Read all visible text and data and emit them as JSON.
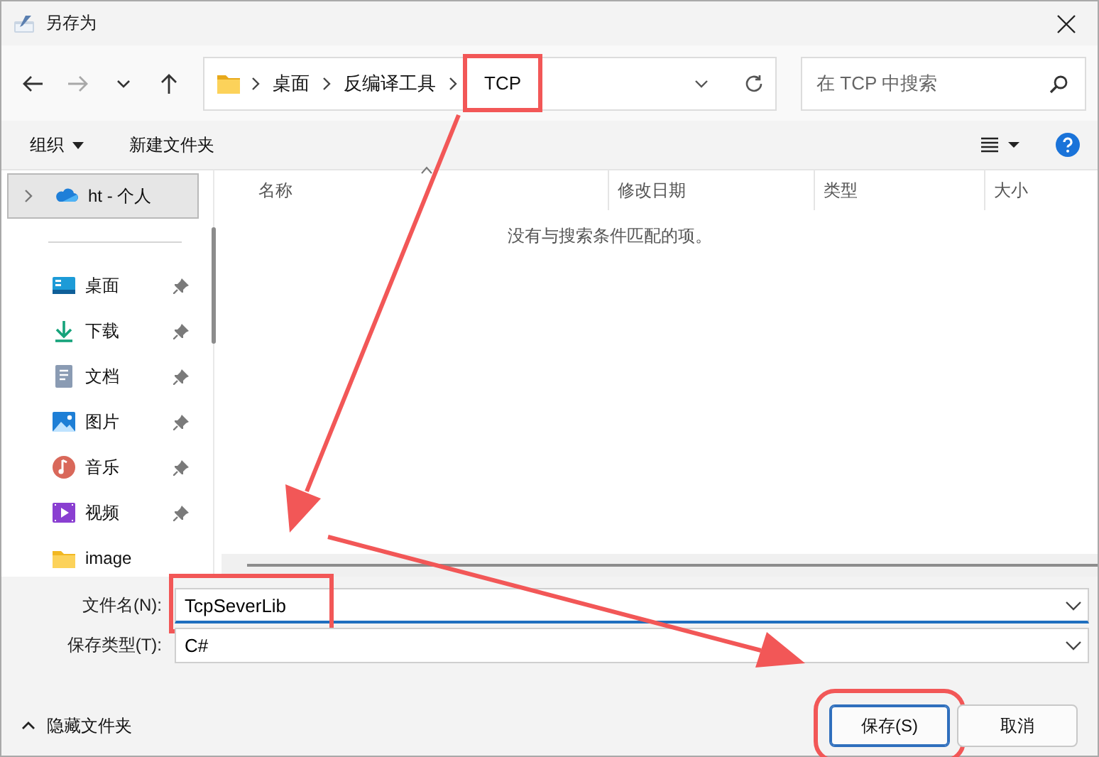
{
  "window": {
    "title": "另存为"
  },
  "nav_buttons": [
    {
      "kind": "back",
      "disabled": false
    },
    {
      "kind": "forward",
      "disabled": true
    },
    {
      "kind": "recent",
      "disabled": false
    },
    {
      "kind": "up",
      "disabled": false
    }
  ],
  "address": {
    "path": [
      {
        "label": "桌面",
        "highlighted": false
      },
      {
        "label": "反编译工具",
        "highlighted": false
      },
      {
        "label": "TCP",
        "highlighted": true
      }
    ]
  },
  "search": {
    "placeholder": "在 TCP 中搜索"
  },
  "toolbar": {
    "organize": "组织",
    "new_folder": "新建文件夹"
  },
  "sidebar": {
    "items": [
      {
        "label": "ht - 个人",
        "kind": "cloud",
        "selected": true,
        "pinned": false
      },
      {
        "label": "桌面",
        "kind": "desktop",
        "selected": false,
        "pinned": true
      },
      {
        "label": "下载",
        "kind": "download",
        "selected": false,
        "pinned": true
      },
      {
        "label": "文档",
        "kind": "documents",
        "selected": false,
        "pinned": true
      },
      {
        "label": "图片",
        "kind": "pictures",
        "selected": false,
        "pinned": true
      },
      {
        "label": "音乐",
        "kind": "music",
        "selected": false,
        "pinned": true
      },
      {
        "label": "视频",
        "kind": "videos",
        "selected": false,
        "pinned": true
      },
      {
        "label": "image",
        "kind": "folder",
        "selected": false,
        "pinned": false
      }
    ]
  },
  "file_list": {
    "columns": [
      {
        "label": "名称",
        "sorted": true
      },
      {
        "label": "修改日期",
        "sorted": false
      },
      {
        "label": "类型",
        "sorted": false
      },
      {
        "label": "大小",
        "sorted": false
      }
    ],
    "empty_message": "没有与搜索条件匹配的项。"
  },
  "fields": [
    {
      "label": "文件名(N):",
      "value": "TcpSeverLib",
      "highlighted": true
    },
    {
      "label": "保存类型(T):",
      "value": "C#",
      "highlighted": false
    }
  ],
  "footer": {
    "toggle": "隐藏文件夹",
    "buttons": [
      {
        "label": "保存(S)",
        "primary": true,
        "highlighted": true
      },
      {
        "label": "取消",
        "primary": false,
        "highlighted": false
      }
    ]
  }
}
